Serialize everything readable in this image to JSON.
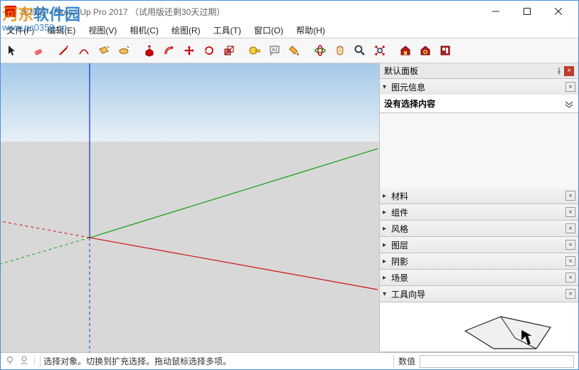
{
  "titlebar": {
    "title": "无标题 - SketchUp Pro 2017 （试用版还剩30天过期）"
  },
  "watermark": {
    "line1_a": "河东",
    "line1_b": "软件园",
    "line2": "www.pc0359.cn"
  },
  "menu": {
    "file": "文件(F)",
    "edit": "编辑(E)",
    "view": "视图(V)",
    "camera": "相机(C)",
    "draw": "绘图(R)",
    "tools": "工具(T)",
    "window": "窗口(O)",
    "help": "帮助(H)"
  },
  "panel": {
    "title": "默认面板",
    "entity": {
      "label": "图元信息",
      "content": "没有选择内容"
    },
    "sections": {
      "materials": "材料",
      "components": "组件",
      "styles": "风格",
      "layers": "图层",
      "shadows": "阴影",
      "scenes": "场景",
      "instructor": "工具向导"
    }
  },
  "status": {
    "tip": "选择对象。切换到扩充选择。拖动鼠标选择多项。",
    "value_label": "数值"
  },
  "toolbar_icons": [
    "select",
    "eraser",
    "line",
    "arc",
    "rect",
    "circle",
    "pushpull",
    "offset",
    "move",
    "rotate",
    "scale",
    "tape",
    "text",
    "paint",
    "orbit",
    "pan",
    "zoom",
    "zoomextents",
    "warehouse",
    "extwarehouse",
    "layout"
  ]
}
